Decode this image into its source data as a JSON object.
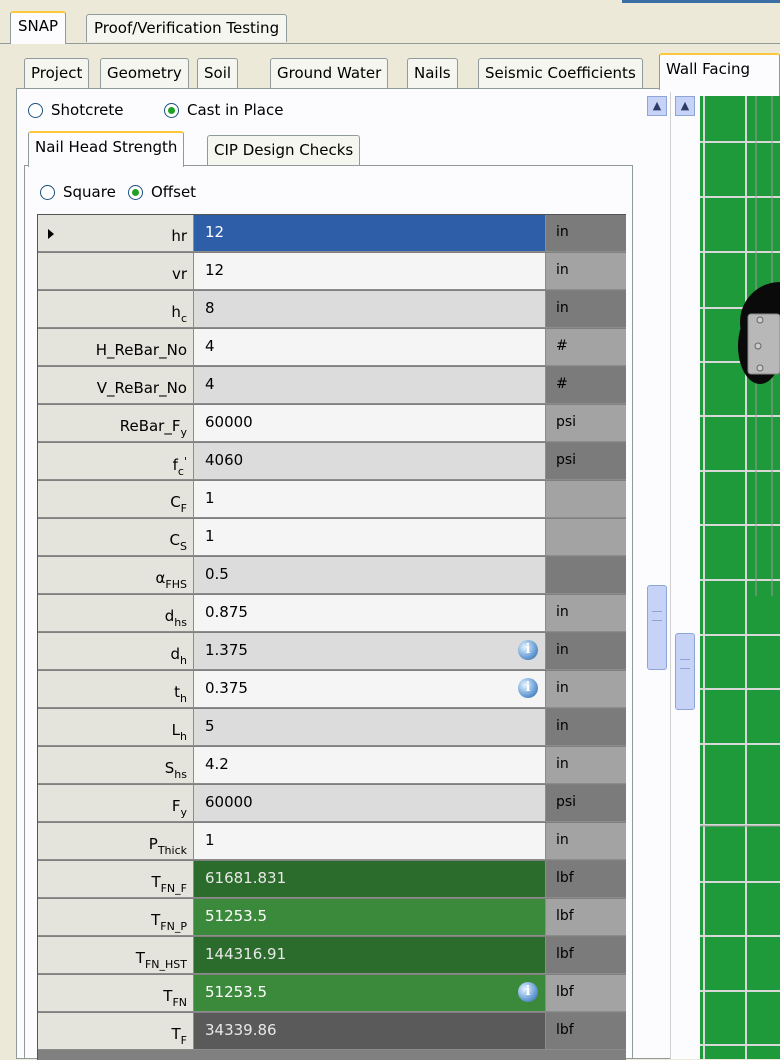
{
  "top_tabs": [
    "SNAP",
    "Proof/Verification Testing"
  ],
  "sub_tabs": [
    "Project",
    "Geometry",
    "Soil",
    "Ground Water",
    "Nails",
    "Seismic Coefficients",
    "Wall Facing"
  ],
  "facing_type": {
    "option1": "Shotcrete",
    "option2": "Cast in Place",
    "selected": "Cast in Place"
  },
  "inner_tabs": [
    "Nail Head Strength",
    "CIP Design Checks"
  ],
  "pattern": {
    "option1": "Square",
    "option2": "Offset",
    "selected": "Offset"
  },
  "rows": [
    {
      "label": "hr",
      "sub": "",
      "value": "12",
      "unit": "in"
    },
    {
      "label": "vr",
      "sub": "",
      "value": "12",
      "unit": "in"
    },
    {
      "label": "h",
      "sub": "c",
      "value": "8",
      "unit": "in"
    },
    {
      "label": "H_ReBar_No",
      "sub": "",
      "value": "4",
      "unit": "#"
    },
    {
      "label": "V_ReBar_No",
      "sub": "",
      "value": "4",
      "unit": "#"
    },
    {
      "label": "ReBar_F",
      "sub": "y",
      "value": "60000",
      "unit": "psi"
    },
    {
      "label": "f",
      "sub": "c",
      "sup": "'",
      "value": "4060",
      "unit": "psi"
    },
    {
      "label": "C",
      "sub": "F",
      "value": "1",
      "unit": ""
    },
    {
      "label": "C",
      "sub": "S",
      "value": "1",
      "unit": ""
    },
    {
      "label": "α",
      "sub": "FHS",
      "value": "0.5",
      "unit": ""
    },
    {
      "label": "d",
      "sub": "hs",
      "value": "0.875",
      "unit": "in"
    },
    {
      "label": "d",
      "sub": "h",
      "value": "1.375",
      "unit": "in",
      "info": true
    },
    {
      "label": "t",
      "sub": "h",
      "value": "0.375",
      "unit": "in",
      "info": true
    },
    {
      "label": "L",
      "sub": "h",
      "value": "5",
      "unit": "in"
    },
    {
      "label": "S",
      "sub": "hs",
      "value": "4.2",
      "unit": "in"
    },
    {
      "label": "F",
      "sub": "y",
      "value": "60000",
      "unit": "psi"
    },
    {
      "label": "P",
      "sub": "Thick",
      "value": "1",
      "unit": "in"
    },
    {
      "label": "T",
      "sub": "FN_F",
      "value": "61681.831",
      "unit": "lbf"
    },
    {
      "label": "T",
      "sub": "FN_P",
      "value": "51253.5",
      "unit": "lbf"
    },
    {
      "label": "T",
      "sub": "FN_HST",
      "value": "144316.91",
      "unit": "lbf"
    },
    {
      "label": "T",
      "sub": "FN",
      "value": "51253.5",
      "unit": "lbf",
      "info": true
    },
    {
      "label": "T",
      "sub": "F",
      "value": "34339.86",
      "unit": "lbf"
    }
  ],
  "info_icon": "info-icon",
  "colors": {
    "selected_cell": "#2f5ea8",
    "result_dark_green": "#2b6b2b",
    "result_green": "#3b8a3b",
    "drawing_green": "#1f9a3a",
    "tab_highlight": "#ffc83c"
  }
}
